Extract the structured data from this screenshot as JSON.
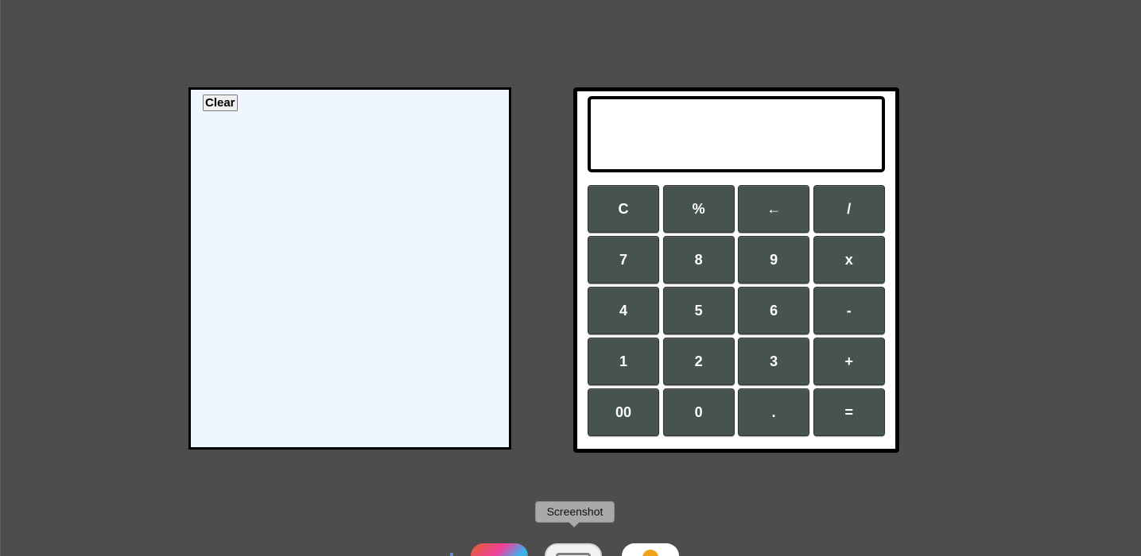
{
  "history": {
    "clear_label": "Clear"
  },
  "calculator": {
    "display_value": "",
    "keys": [
      {
        "label": "C",
        "name": "clear-key"
      },
      {
        "label": "%",
        "name": "percent-key"
      },
      {
        "label": "←",
        "name": "backspace-key"
      },
      {
        "label": "/",
        "name": "divide-key"
      },
      {
        "label": "7",
        "name": "digit-7-key"
      },
      {
        "label": "8",
        "name": "digit-8-key"
      },
      {
        "label": "9",
        "name": "digit-9-key"
      },
      {
        "label": "x",
        "name": "multiply-key"
      },
      {
        "label": "4",
        "name": "digit-4-key"
      },
      {
        "label": "5",
        "name": "digit-5-key"
      },
      {
        "label": "6",
        "name": "digit-6-key"
      },
      {
        "label": "-",
        "name": "subtract-key"
      },
      {
        "label": "1",
        "name": "digit-1-key"
      },
      {
        "label": "2",
        "name": "digit-2-key"
      },
      {
        "label": "3",
        "name": "digit-3-key"
      },
      {
        "label": "+",
        "name": "add-key"
      },
      {
        "label": "00",
        "name": "double-zero-key"
      },
      {
        "label": "0",
        "name": "digit-0-key"
      },
      {
        "label": ".",
        "name": "decimal-key"
      },
      {
        "label": "=",
        "name": "equals-key"
      }
    ]
  },
  "dock": {
    "tooltip": "Screenshot",
    "icons": [
      "photos-icon",
      "screenshot-icon",
      "app-icon"
    ]
  },
  "colors": {
    "background": "#4d4d4d",
    "history_bg": "#eff6ff",
    "key_bg": "#475351",
    "key_text": "#ffffff"
  }
}
